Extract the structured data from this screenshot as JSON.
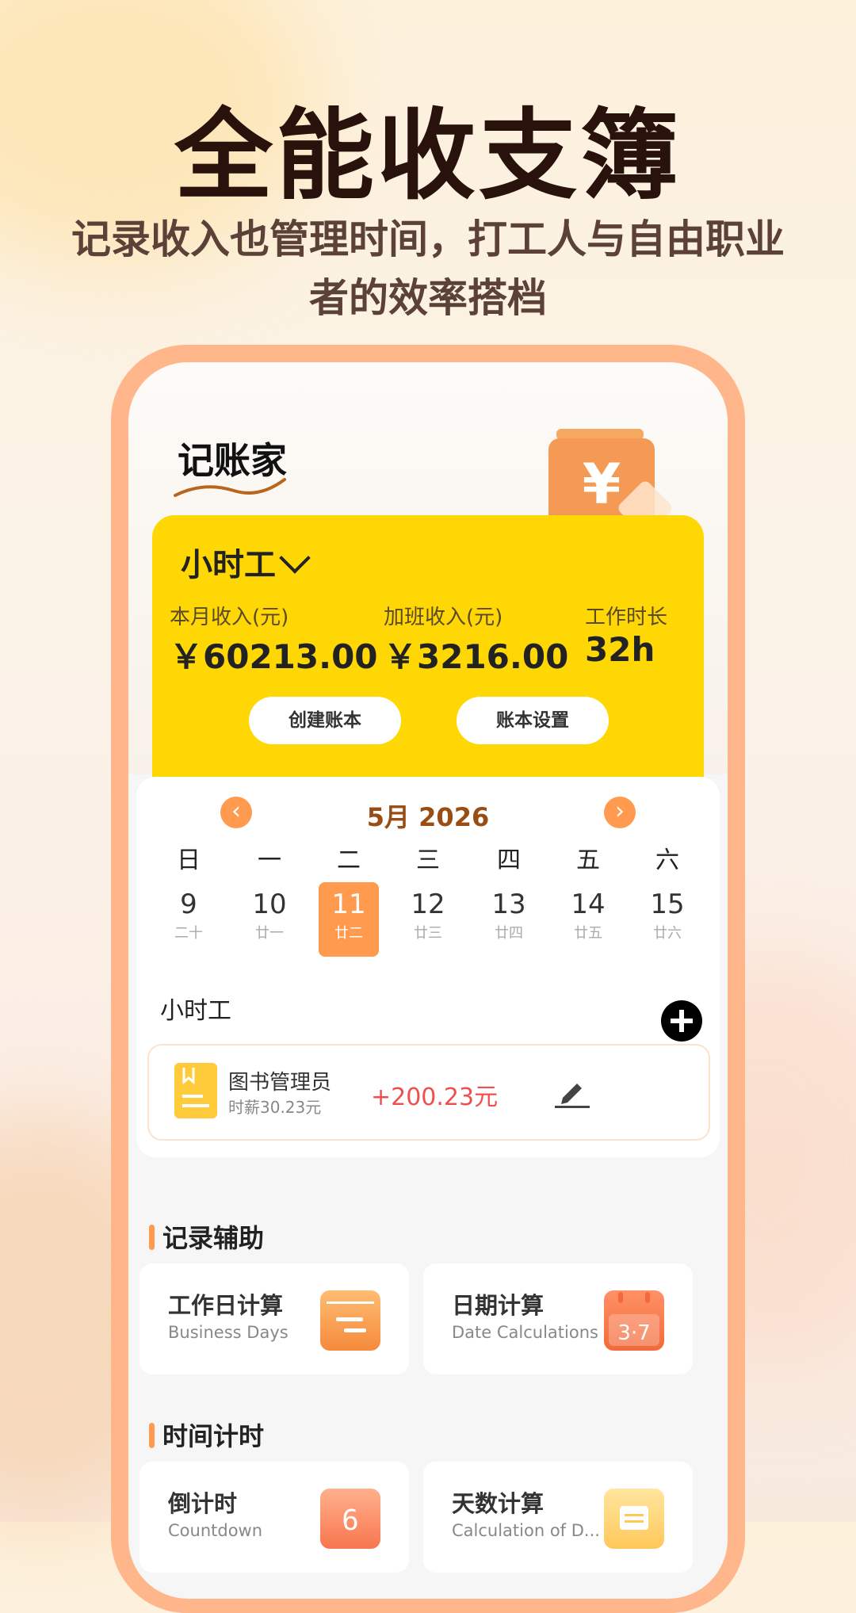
{
  "promo": {
    "headline": "全能收支簿",
    "subline": "记录收入也管理时间，打工人与自由职业者的效率搭档"
  },
  "app": {
    "logo_text": "记账家",
    "book": {
      "title": "小时工",
      "stats": [
        {
          "label": "本月收入(元)",
          "value": "￥60213.00"
        },
        {
          "label": "加班收入(元)",
          "value": "￥3216.00"
        },
        {
          "label": "工作时长",
          "value": "32h"
        }
      ],
      "buttons": {
        "create": "创建账本",
        "settings": "账本设置"
      }
    },
    "calendar": {
      "month_label": "5月  2026",
      "weekdays": [
        "日",
        "一",
        "二",
        "三",
        "四",
        "五",
        "六"
      ],
      "days": [
        {
          "num": "9",
          "lunar": "二十"
        },
        {
          "num": "10",
          "lunar": "廿一"
        },
        {
          "num": "11",
          "lunar": "廿二"
        },
        {
          "num": "12",
          "lunar": "廿三"
        },
        {
          "num": "13",
          "lunar": "廿四"
        },
        {
          "num": "14",
          "lunar": "廿五"
        },
        {
          "num": "15",
          "lunar": "廿六"
        }
      ],
      "selected_index": 2
    },
    "records_section": {
      "title": "小时工",
      "record": {
        "name": "图书管理员",
        "rate": "时薪30.23元",
        "amount": "+200.23元"
      }
    },
    "assist": {
      "title": "记录辅助",
      "tools": [
        {
          "cn": "工作日计算",
          "en": "Business Days",
          "icon": "calendar-lines-icon"
        },
        {
          "cn": "日期计算",
          "en": "Date Calculations",
          "icon": "calendar-37-icon"
        }
      ]
    },
    "timer": {
      "title": "时间计时",
      "tools": [
        {
          "cn": "倒计时",
          "en": "Countdown",
          "icon": "countdown-6-icon"
        },
        {
          "cn": "天数计算",
          "en": "Calculation of D...",
          "icon": "calendar-grid-icon"
        }
      ]
    }
  },
  "colors": {
    "accent": "#ff9a4f",
    "book_card": "#ffd704",
    "phone_frame": "#ffb68a",
    "amount_red": "#ef4f4f"
  }
}
